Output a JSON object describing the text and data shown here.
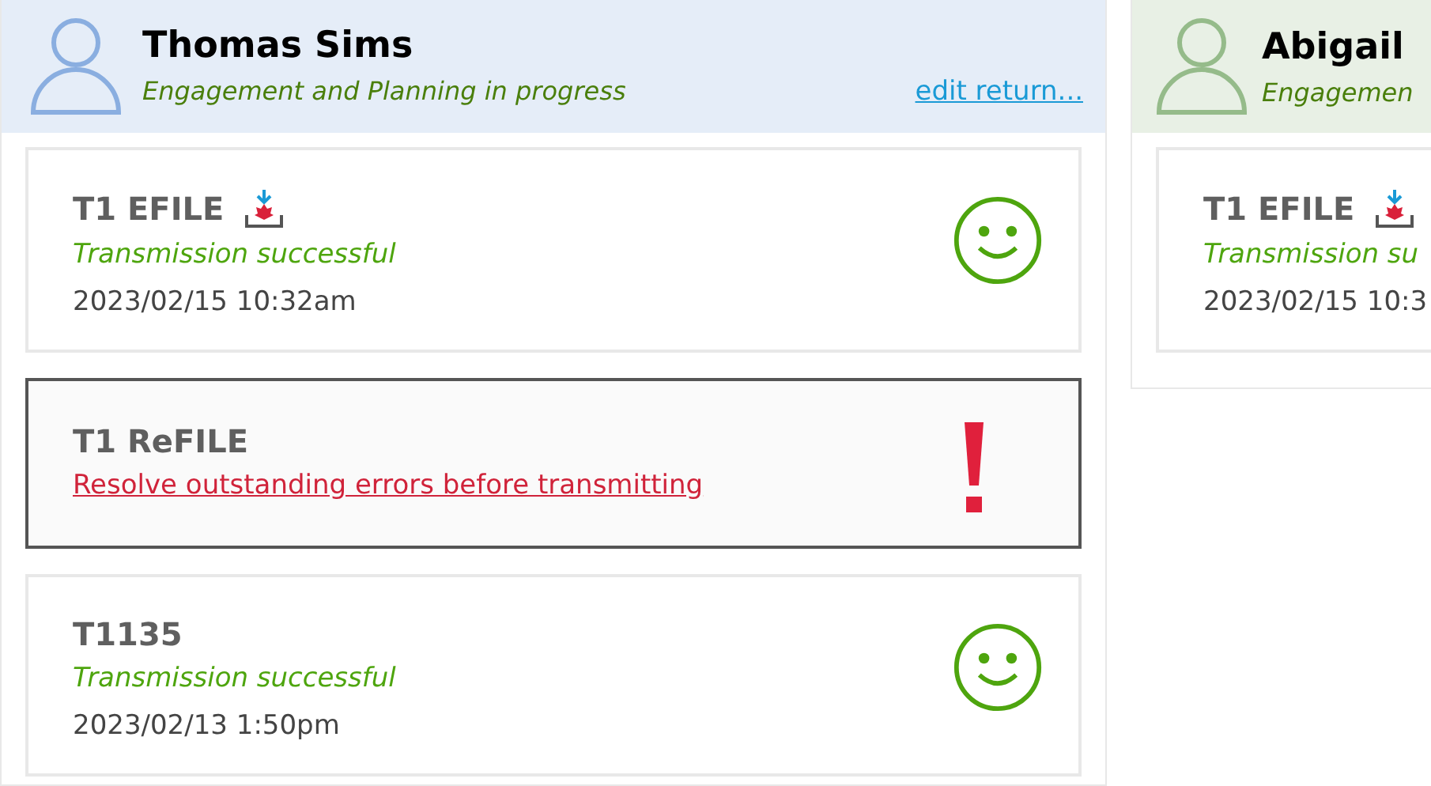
{
  "clients": [
    {
      "name": "Thomas Sims",
      "status": "Engagement and Planning in progress",
      "color": "#8aaee0",
      "link": "edit return...",
      "cards": [
        {
          "title": "T1 EFILE",
          "efile_icon": true,
          "kind": "success",
          "message": "Transmission successful",
          "date": "2023/02/15 10:32am",
          "selected": false
        },
        {
          "title": "T1 ReFILE",
          "efile_icon": false,
          "kind": "error",
          "message": "Resolve outstanding errors before transmitting",
          "selected": true
        },
        {
          "title": "T1135",
          "efile_icon": false,
          "kind": "success",
          "message": "Transmission successful",
          "date": "2023/02/13 1:50pm",
          "selected": false
        }
      ]
    },
    {
      "name": "Abigail",
      "status": "Engagemen",
      "color": "#95bb8a",
      "cards": [
        {
          "title": "T1 EFILE",
          "efile_icon": true,
          "kind": "success",
          "message": "Transmission su",
          "date": "2023/02/15 10:3",
          "selected": false
        }
      ]
    }
  ]
}
